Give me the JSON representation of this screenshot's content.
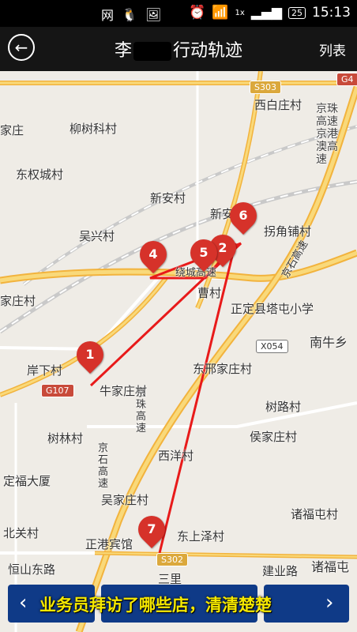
{
  "statusbar": {
    "left_text": "网",
    "signal_badge": "1x",
    "battery": "25",
    "time": "15:13"
  },
  "header": {
    "back_label": "返回",
    "title_prefix": "李",
    "title_suffix": "行动轨迹",
    "list_label": "列表"
  },
  "map": {
    "places": [
      "西白庄村",
      "柳树科村",
      "家庄",
      "东权城村",
      "新安村",
      "吴兴村",
      "新安",
      "拐角铺村",
      "绕城高速",
      "曹村",
      "家庄村",
      "正定县塔屯小学",
      "南牛乡",
      "岸下村",
      "牛家庄村",
      "东邢家庄村",
      "树路村",
      "树林村",
      "侯家庄村",
      "西洋村",
      "定福大厦",
      "吴家庄村",
      "诸福屯村",
      "北关村",
      "正港宾馆",
      "东上泽村",
      "恒山东路",
      "三里",
      "建业路",
      "诸福屯",
      "京珠高速京港澳高速",
      "京石高速",
      "京珠高速",
      "京石高速"
    ],
    "shields": [
      "S303",
      "G4",
      "X054",
      "G107",
      "S302"
    ],
    "markers": [
      "1",
      "2",
      "4",
      "5",
      "6",
      "7"
    ]
  },
  "banner": {
    "text": "业务员拜访了哪些店，清清楚楚",
    "left_arrow": "‹",
    "right_arrow": "›"
  }
}
